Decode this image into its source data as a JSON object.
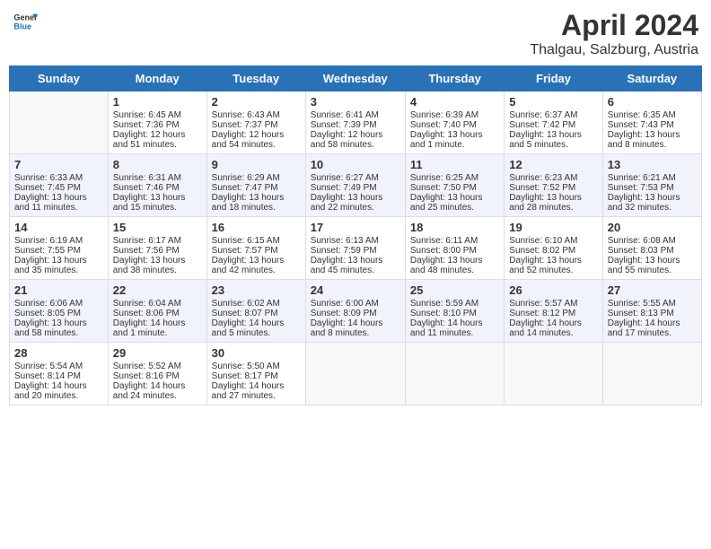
{
  "header": {
    "logo_general": "General",
    "logo_blue": "Blue",
    "month": "April 2024",
    "location": "Thalgau, Salzburg, Austria"
  },
  "days_of_week": [
    "Sunday",
    "Monday",
    "Tuesday",
    "Wednesday",
    "Thursday",
    "Friday",
    "Saturday"
  ],
  "weeks": [
    [
      {
        "day": "",
        "content": ""
      },
      {
        "day": "1",
        "content": "Sunrise: 6:45 AM\nSunset: 7:36 PM\nDaylight: 12 hours\nand 51 minutes."
      },
      {
        "day": "2",
        "content": "Sunrise: 6:43 AM\nSunset: 7:37 PM\nDaylight: 12 hours\nand 54 minutes."
      },
      {
        "day": "3",
        "content": "Sunrise: 6:41 AM\nSunset: 7:39 PM\nDaylight: 12 hours\nand 58 minutes."
      },
      {
        "day": "4",
        "content": "Sunrise: 6:39 AM\nSunset: 7:40 PM\nDaylight: 13 hours\nand 1 minute."
      },
      {
        "day": "5",
        "content": "Sunrise: 6:37 AM\nSunset: 7:42 PM\nDaylight: 13 hours\nand 5 minutes."
      },
      {
        "day": "6",
        "content": "Sunrise: 6:35 AM\nSunset: 7:43 PM\nDaylight: 13 hours\nand 8 minutes."
      }
    ],
    [
      {
        "day": "7",
        "content": "Sunrise: 6:33 AM\nSunset: 7:45 PM\nDaylight: 13 hours\nand 11 minutes."
      },
      {
        "day": "8",
        "content": "Sunrise: 6:31 AM\nSunset: 7:46 PM\nDaylight: 13 hours\nand 15 minutes."
      },
      {
        "day": "9",
        "content": "Sunrise: 6:29 AM\nSunset: 7:47 PM\nDaylight: 13 hours\nand 18 minutes."
      },
      {
        "day": "10",
        "content": "Sunrise: 6:27 AM\nSunset: 7:49 PM\nDaylight: 13 hours\nand 22 minutes."
      },
      {
        "day": "11",
        "content": "Sunrise: 6:25 AM\nSunset: 7:50 PM\nDaylight: 13 hours\nand 25 minutes."
      },
      {
        "day": "12",
        "content": "Sunrise: 6:23 AM\nSunset: 7:52 PM\nDaylight: 13 hours\nand 28 minutes."
      },
      {
        "day": "13",
        "content": "Sunrise: 6:21 AM\nSunset: 7:53 PM\nDaylight: 13 hours\nand 32 minutes."
      }
    ],
    [
      {
        "day": "14",
        "content": "Sunrise: 6:19 AM\nSunset: 7:55 PM\nDaylight: 13 hours\nand 35 minutes."
      },
      {
        "day": "15",
        "content": "Sunrise: 6:17 AM\nSunset: 7:56 PM\nDaylight: 13 hours\nand 38 minutes."
      },
      {
        "day": "16",
        "content": "Sunrise: 6:15 AM\nSunset: 7:57 PM\nDaylight: 13 hours\nand 42 minutes."
      },
      {
        "day": "17",
        "content": "Sunrise: 6:13 AM\nSunset: 7:59 PM\nDaylight: 13 hours\nand 45 minutes."
      },
      {
        "day": "18",
        "content": "Sunrise: 6:11 AM\nSunset: 8:00 PM\nDaylight: 13 hours\nand 48 minutes."
      },
      {
        "day": "19",
        "content": "Sunrise: 6:10 AM\nSunset: 8:02 PM\nDaylight: 13 hours\nand 52 minutes."
      },
      {
        "day": "20",
        "content": "Sunrise: 6:08 AM\nSunset: 8:03 PM\nDaylight: 13 hours\nand 55 minutes."
      }
    ],
    [
      {
        "day": "21",
        "content": "Sunrise: 6:06 AM\nSunset: 8:05 PM\nDaylight: 13 hours\nand 58 minutes."
      },
      {
        "day": "22",
        "content": "Sunrise: 6:04 AM\nSunset: 8:06 PM\nDaylight: 14 hours\nand 1 minute."
      },
      {
        "day": "23",
        "content": "Sunrise: 6:02 AM\nSunset: 8:07 PM\nDaylight: 14 hours\nand 5 minutes."
      },
      {
        "day": "24",
        "content": "Sunrise: 6:00 AM\nSunset: 8:09 PM\nDaylight: 14 hours\nand 8 minutes."
      },
      {
        "day": "25",
        "content": "Sunrise: 5:59 AM\nSunset: 8:10 PM\nDaylight: 14 hours\nand 11 minutes."
      },
      {
        "day": "26",
        "content": "Sunrise: 5:57 AM\nSunset: 8:12 PM\nDaylight: 14 hours\nand 14 minutes."
      },
      {
        "day": "27",
        "content": "Sunrise: 5:55 AM\nSunset: 8:13 PM\nDaylight: 14 hours\nand 17 minutes."
      }
    ],
    [
      {
        "day": "28",
        "content": "Sunrise: 5:54 AM\nSunset: 8:14 PM\nDaylight: 14 hours\nand 20 minutes."
      },
      {
        "day": "29",
        "content": "Sunrise: 5:52 AM\nSunset: 8:16 PM\nDaylight: 14 hours\nand 24 minutes."
      },
      {
        "day": "30",
        "content": "Sunrise: 5:50 AM\nSunset: 8:17 PM\nDaylight: 14 hours\nand 27 minutes."
      },
      {
        "day": "",
        "content": ""
      },
      {
        "day": "",
        "content": ""
      },
      {
        "day": "",
        "content": ""
      },
      {
        "day": "",
        "content": ""
      }
    ]
  ]
}
